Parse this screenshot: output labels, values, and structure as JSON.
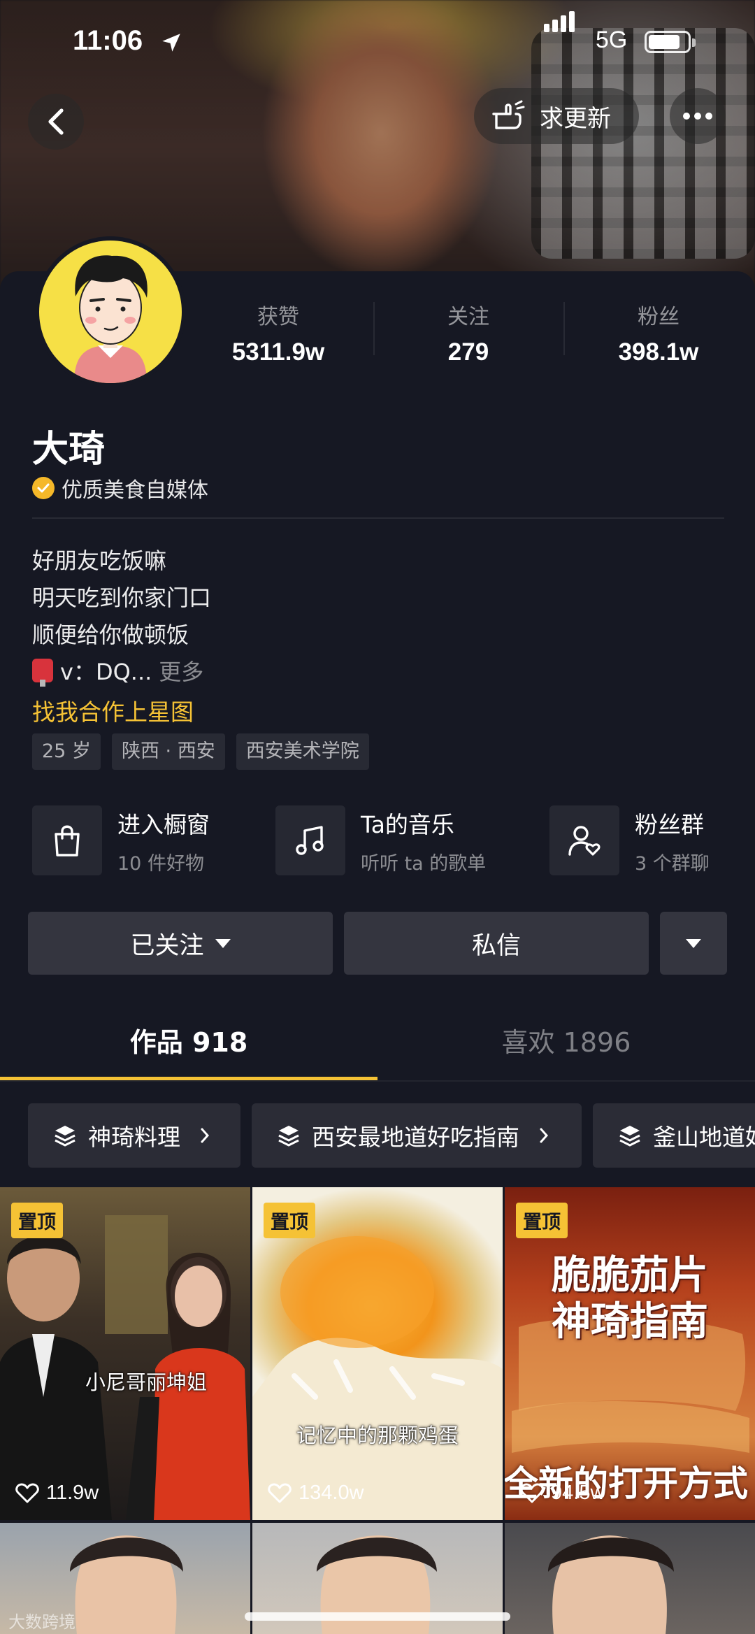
{
  "status_bar": {
    "time": "11:06",
    "network": "5G"
  },
  "nav": {
    "request_update_label": "求更新"
  },
  "profile": {
    "name": "大琦",
    "verified_label": "优质美食自媒体",
    "stats": [
      {
        "label": "获赞",
        "value": "5311.9w"
      },
      {
        "label": "关注",
        "value": "279"
      },
      {
        "label": "粉丝",
        "value": "398.1w"
      }
    ],
    "bio_lines": [
      "好朋友吃饭嘛",
      "明天吃到你家门口",
      "顺便给你做顿饭"
    ],
    "contact": "v：DQ...",
    "more_label": "更多",
    "star_link": "找我合作上星图",
    "tags": [
      "25 岁",
      "陕西 · 西安",
      "西安美术学院"
    ]
  },
  "features": [
    {
      "title": "进入橱窗",
      "subtitle": "10 件好物",
      "icon": "shopping-bag-icon"
    },
    {
      "title": "Ta的音乐",
      "subtitle": "听听 ta 的歌单",
      "icon": "music-note-icon"
    },
    {
      "title": "粉丝群",
      "subtitle": "3 个群聊",
      "icon": "fan-group-icon"
    }
  ],
  "actions": {
    "followed": "已关注",
    "message": "私信"
  },
  "tabs": [
    {
      "label": "作品 918",
      "active": true
    },
    {
      "label": "喜欢 1896",
      "active": false
    }
  ],
  "collections": [
    "神琦料理",
    "西安最地道好吃指南",
    "釜山地道好"
  ],
  "videos": [
    {
      "pinned": "置顶",
      "likes": "11.9w",
      "caption": "小尼哥丽坤姐"
    },
    {
      "pinned": "置顶",
      "likes": "134.0w",
      "caption": "记忆中的那颗鸡蛋"
    },
    {
      "pinned": "置顶",
      "likes": "94.5w",
      "caption_line1": "脆脆茄片",
      "caption_line2": "神琦指南",
      "caption_bottom": "全新的打开方式"
    }
  ],
  "watermark": "大数跨境",
  "colors": {
    "accent": "#f5c235",
    "background": "#161823"
  }
}
